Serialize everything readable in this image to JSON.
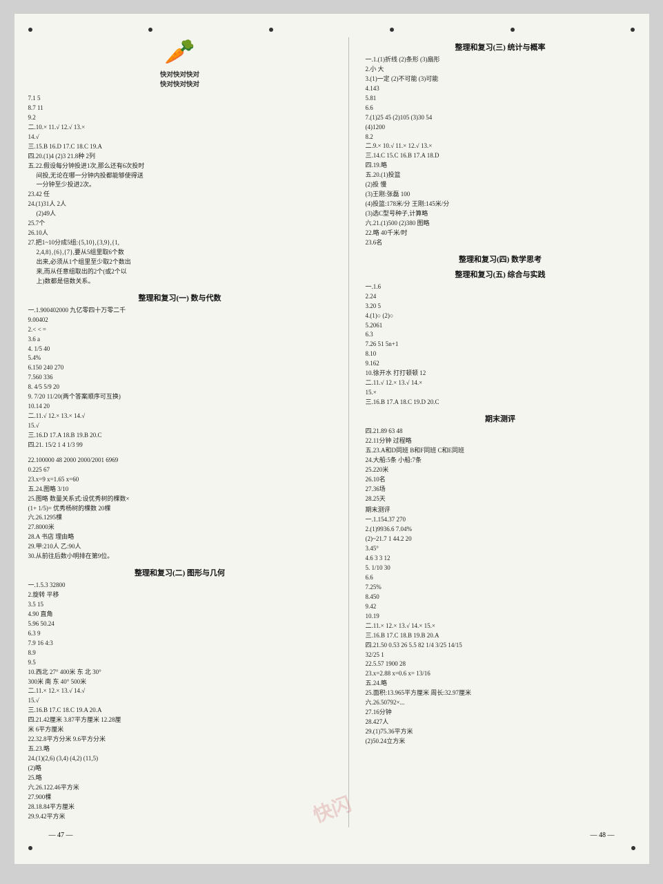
{
  "header": {
    "page_left": "— 47 —",
    "page_right": "— 48 —"
  },
  "left_page": {
    "top_items": [
      "7.1  5",
      "8.7  11",
      "9.2",
      "二.10.×   11.√   12.√   13.×",
      "14.√",
      "三.15.B   16.D   17.C   18.C   19.A",
      "四.20.(1)4  (2)3   21.8种  2列",
      "五.22.假设每分钟投进1次,那么还有6次投时",
      "间投,无论在哪一分钟内投都能够使得送",
      "一分钟至少投进2次。",
      "23.42 任",
      "24.(1)31人  2人",
      "(2)49人",
      "25.7个",
      "26.10人",
      "27.把1~10分成5组:{5,10},{3,9},{1,",
      "2,4,8},{6},{7},要从5组里取6个数",
      "出来,必须从1个组里至少取2个数出",
      "来,而从任意组取出的2个(或2个以",
      "上)数都是倍数关系。"
    ],
    "section1": {
      "title": "整理和复习(一) 数与代数",
      "items": [
        "一.1.900402000  九亿零四十万零二千",
        "9.00402",
        "2.< < =",
        "3.6  a",
        "4. 1/5  40",
        "5.4%",
        "6.150  240  270",
        "7.560  336",
        "8. 4/5  5/9  20",
        "9. 7/20  11/20(两个答案顺序可互换)",
        "10.14  20",
        "二.11.√   12.×   13.×   14.√",
        "15.√",
        "三.16.D   17.A   18.B   19.B   20.C",
        "四.21. 15/2  1  4  1/3  99"
      ]
    },
    "section2_left": {
      "title": "快对快对快对",
      "subtitle": "快对快对快对",
      "items": [
        "22.100000  48  2000  2000/2001  6969",
        "0.225  67",
        "23.x=9  x=1.65  x=60",
        "五.24.图略  3/10",
        "25.图略   数量关系式:设优秀树的棵数×",
        "(1+ 1/5)= 优秀杨树的棵数  20棵",
        "六.26.1295棵",
        "27.8000米",
        "28.A 书店  理由略",
        "29.甲:210人  乙:90人",
        "30.从前往后数小明排在第9位。"
      ]
    },
    "section3": {
      "title": "整理和复习(二) 图形与几何",
      "items": [
        "一.1.5.3  32800",
        "2.旋转  平移",
        "3.5  15",
        "4.90  直角",
        "5.96  50.24",
        "6.3  9",
        "7.9  16  4:3",
        "8.9",
        "9.5",
        "10.西北  27°  400米  东  北  30°",
        "300米  南  东  40°  500米",
        "二.11.×   12.×   13.√   14.√",
        "15.√",
        "三.16.B   17.C   18.C   19.A   20.A",
        "四.21.42厘米  3.87平方厘米  12.28厘",
        "米  6平方厘米",
        "22.32.8平方分米  9.6平方分米",
        "五.23.略",
        "24.(1)(2,6)  (3,4)  (4,2)  (11,5)",
        "(2)略",
        "25.略",
        "六.26.122.46平方米",
        "27.900棵",
        "28.18.84平方厘米",
        "29.9.42平方米"
      ]
    }
  },
  "right_page": {
    "section4": {
      "title": "整理和复习(三) 统计与概率",
      "items": [
        "一.1.(1)折线  (2)条形  (3)扇形",
        "2.小  大",
        "3.(1)一定  (2)不可能  (3)可能",
        "4.143",
        "5.81",
        "6.6",
        "7.(1)25  45  (2)105  (3)30  54",
        "(4)1200",
        "8.2",
        "二.9.×   10.√   11.×   12.√   13.×",
        "三.14.C   15.C   16.B   17.A   18.D",
        "四.19.略",
        "五.20.(1)投篮",
        "(2)投  慢",
        "(3)王刚:张磊  100",
        "(4)投篮:178米/分  王刚:145米/分",
        "(3)选C型号种子,计算略",
        "六.21.(1)500  (2)380  图略",
        "22.略  40千米/时",
        "23.6名"
      ]
    },
    "section5": {
      "title": "整理和复习(四) 数学思考",
      "subtitle": "整理和复习(五) 综合与实践",
      "items": [
        "一.1.6",
        "2.24",
        "3.20  5",
        "4.(1)○  (2)○",
        "5.2061",
        "6.3",
        "7.26  51  5n+1",
        "8.10",
        "9.162",
        "10.徐开水  打打顿顿  12",
        "二.11.√   12.×   13.√   14.×",
        "15.×",
        "三.16.B   17.A   18.C   19.D   20.C"
      ]
    },
    "section6": {
      "title": "期末测评",
      "items": [
        "四.21.89  63  48",
        "22.11分钟  过程略",
        "五.23.A和D同班  B和F同班  C和E同班",
        "24.大船:5条  小船:7条",
        "25.220米",
        "26.10名",
        "27.36场",
        "28.25天",
        "",
        "期末测评",
        "一.1.154.37  270",
        "2.(1)9936.6  7.04%",
        "(2)~21.7  1  44.2  20",
        "3.45°",
        "4.6  3  3  12",
        "5. 1/10  30",
        "6.6",
        "7.25%",
        "8.450",
        "9.42",
        "10.19",
        "二.11.×   12.×   13.√   14.×   15.×",
        "三.16.B   17.C   18.B   19.B   20.A",
        "四.21.50  0.53  26  5.5  82  1/4  3/25  14/15",
        "32/25  1",
        "22.5.57  1900  28",
        "23.x=2.88  x=0.6  x= 13/16",
        "五.24.略",
        "25.面积:13.965平方厘米  周长:32.97厘米",
        "六.26.50792×...",
        "27.16分钟",
        "28.427人",
        "29.(1)75.36平方米",
        "(2)50.24立方米"
      ]
    }
  }
}
